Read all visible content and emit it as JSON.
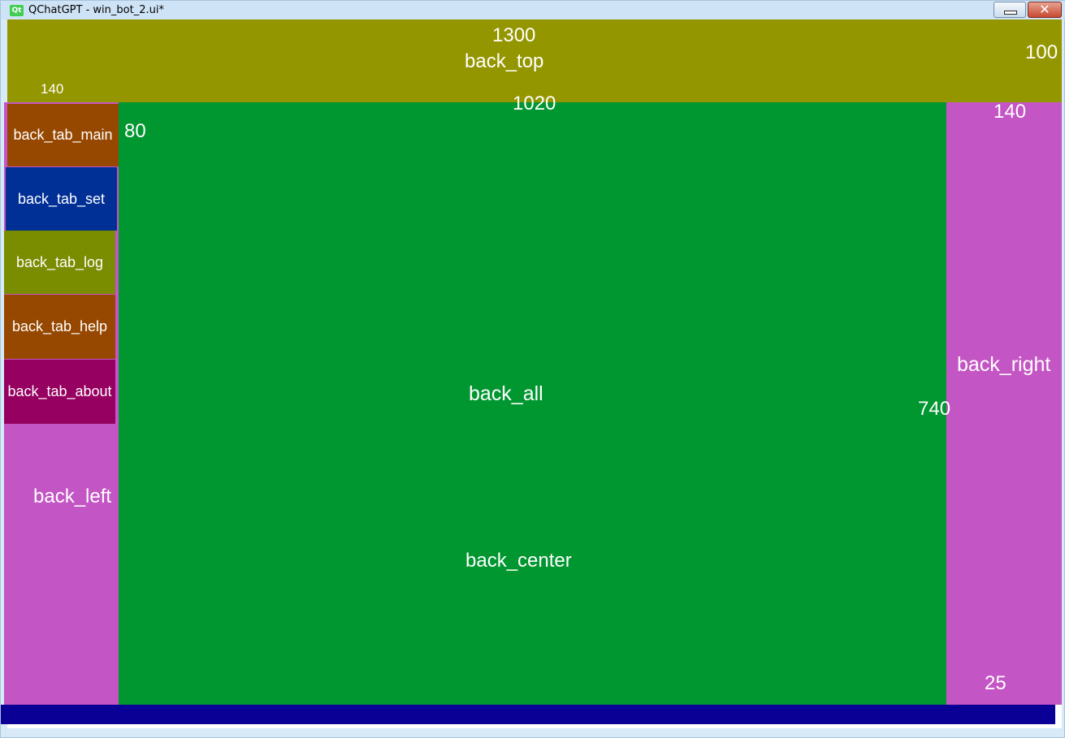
{
  "window": {
    "app_icon": "qt-logo-icon",
    "app_icon_text": "Qt",
    "title": "QChatGPT - win_bot_2.ui*",
    "minimize_label": "",
    "close_label": "✕"
  },
  "panels": {
    "top": {
      "label": "back_top",
      "width_value": "1300",
      "height_value": "100"
    },
    "left": {
      "label": "back_left",
      "width_value": "140"
    },
    "center": {
      "label_all": "back_all",
      "label_center": "back_center",
      "width_value": "1020",
      "height_value": "740",
      "tab_height_value": "80"
    },
    "right": {
      "label": "back_right",
      "width_value": "140",
      "bottom_value": "25"
    }
  },
  "tabs": [
    {
      "label": "back_tab_main",
      "color": "#964800"
    },
    {
      "label": "back_tab_set",
      "color": "#003096"
    },
    {
      "label": "back_tab_log",
      "color": "#7a8c00"
    },
    {
      "label": "back_tab_help",
      "color": "#964800"
    },
    {
      "label": "back_tab_about",
      "color": "#960060"
    }
  ],
  "colors": {
    "top": "#949600",
    "left": "#c455c4",
    "center": "#009630",
    "right": "#c455c4",
    "bottom": "#0a0096"
  }
}
